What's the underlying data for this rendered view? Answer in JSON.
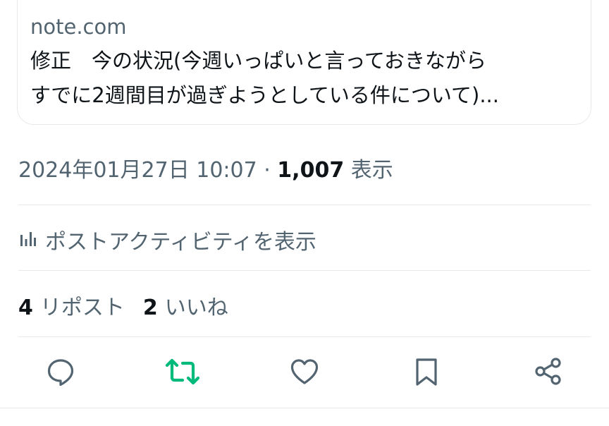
{
  "link_card": {
    "domain": "note.com",
    "title_line1": "修正　今の状況(今週いっぱいと言っておきながら",
    "title_line2": "すでに2週間目が過ぎようとしている件について)..."
  },
  "post_meta": {
    "timestamp": "2024年01月27日 10:07",
    "separator": " · ",
    "views_count": "1,007",
    "views_label": " 表示"
  },
  "activity": {
    "icon": "bar-chart-icon",
    "label": "ポストアクティビティを表示"
  },
  "engagement": {
    "reposts_count": "4",
    "reposts_label": "リポスト",
    "likes_count": "2",
    "likes_label": "いいね"
  },
  "actions": [
    {
      "icon": "reply-icon"
    },
    {
      "icon": "repost-icon",
      "color": "#00ba7c"
    },
    {
      "icon": "like-icon"
    },
    {
      "icon": "bookmark-icon"
    },
    {
      "icon": "share-icon"
    }
  ],
  "colors": {
    "text_primary": "#0f1419",
    "text_secondary": "#536471",
    "repost_active": "#00ba7c",
    "divider": "#e6e9eb"
  }
}
